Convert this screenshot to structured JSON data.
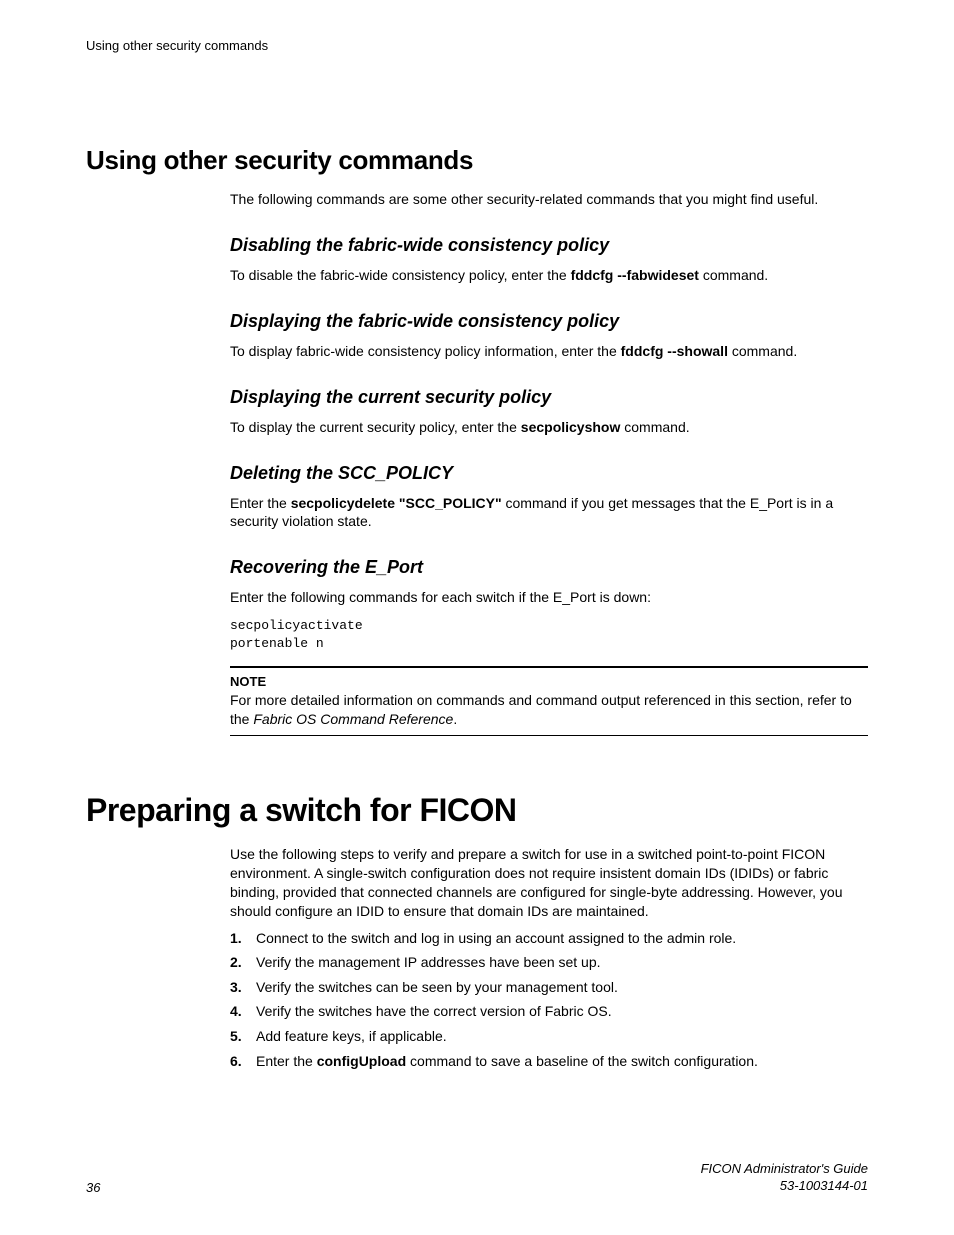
{
  "header": {
    "running": "Using other security commands"
  },
  "sections": {
    "h2_title": "Using other security commands",
    "intro": "The following commands are some other security-related commands that you might find useful.",
    "disable": {
      "title": "Disabling the fabric-wide consistency policy",
      "pre": "To disable the fabric-wide consistency policy, enter the ",
      "cmd": "fddcfg --fabwideset",
      "post": " command."
    },
    "display_fabric": {
      "title": "Displaying the fabric-wide consistency policy",
      "pre": "To display fabric-wide consistency policy information, enter the ",
      "cmd": "fddcfg --showall",
      "post": " command."
    },
    "display_security": {
      "title": "Displaying the current security policy",
      "pre": "To display the current security policy, enter the ",
      "cmd": "secpolicyshow",
      "post": " command."
    },
    "delete_scc": {
      "title": "Deleting the SCC_POLICY",
      "pre": "Enter the ",
      "cmd": "secpolicydelete \"SCC_POLICY\"",
      "post": " command if you get messages that the E_Port is in a security violation state."
    },
    "recover": {
      "title": "Recovering the E_Port",
      "desc": "Enter the following commands for each switch if the E_Port is down:",
      "code": "secpolicyactivate\nportenable n"
    },
    "note": {
      "label": "NOTE",
      "text_pre": "For more detailed information on commands and command output referenced in this section, refer to the ",
      "ref": "Fabric OS Command Reference",
      "text_post": "."
    }
  },
  "h1": {
    "title": "Preparing a switch for FICON",
    "intro": "Use the following steps to verify and prepare a switch for use in a switched point-to-point FICON environment. A single-switch configuration does not require insistent domain IDs (IDIDs) or fabric binding, provided that connected channels are configured for single-byte addressing. However, you should configure an IDID to ensure that domain IDs are maintained.",
    "steps": [
      {
        "n": "1.",
        "text": "Connect to the switch and log in using an account assigned to the admin role."
      },
      {
        "n": "2.",
        "text": "Verify the management IP addresses have been set up."
      },
      {
        "n": "3.",
        "text": "Verify the switches can be seen by your management tool."
      },
      {
        "n": "4.",
        "text": "Verify the switches have the correct version of Fabric OS."
      },
      {
        "n": "5.",
        "text": "Add feature keys, if applicable."
      },
      {
        "n": "6.",
        "pre": "Enter the ",
        "cmd": "configUpload",
        "post": " command to save a baseline of the switch configuration."
      }
    ]
  },
  "footer": {
    "page": "36",
    "guide": "FICON Administrator's Guide",
    "docnum": "53-1003144-01"
  }
}
